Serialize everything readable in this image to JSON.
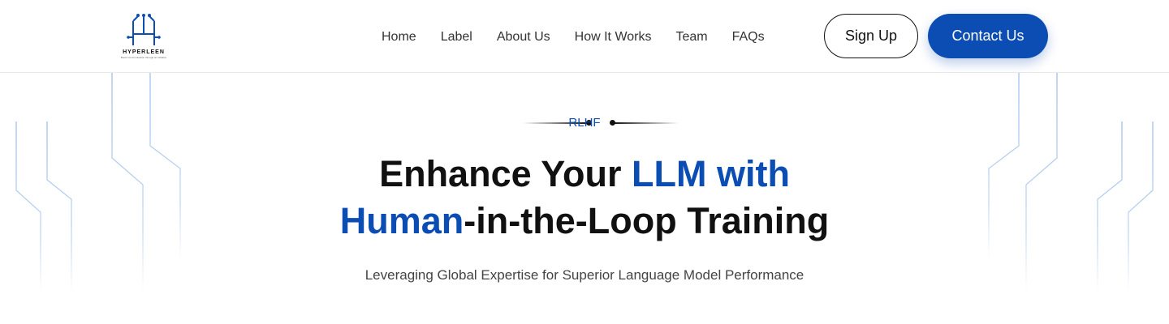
{
  "brand": {
    "name": "HYPERLEEN",
    "tagline": "Boost Communication through an Initiative",
    "logo_icon": "circuit-h-logo-icon",
    "accent_color": "#0c4db3"
  },
  "nav": {
    "items": [
      {
        "label": "Home"
      },
      {
        "label": "Label"
      },
      {
        "label": "About Us"
      },
      {
        "label": "How It Works"
      },
      {
        "label": "Team"
      },
      {
        "label": "FAQs"
      }
    ]
  },
  "header_actions": {
    "signup_label": "Sign Up",
    "contact_label": "Contact Us"
  },
  "hero": {
    "eyebrow": "RLHF",
    "headline_part1": "Enhance Your ",
    "headline_accent1": "LLM with",
    "headline_accent2": "Human",
    "headline_part2": "-in-the-Loop Training",
    "subheadline": "Leveraging Global Expertise for Superior Language Model Performance"
  },
  "decor": {
    "circuit_line_color": "#8fb2ea"
  }
}
